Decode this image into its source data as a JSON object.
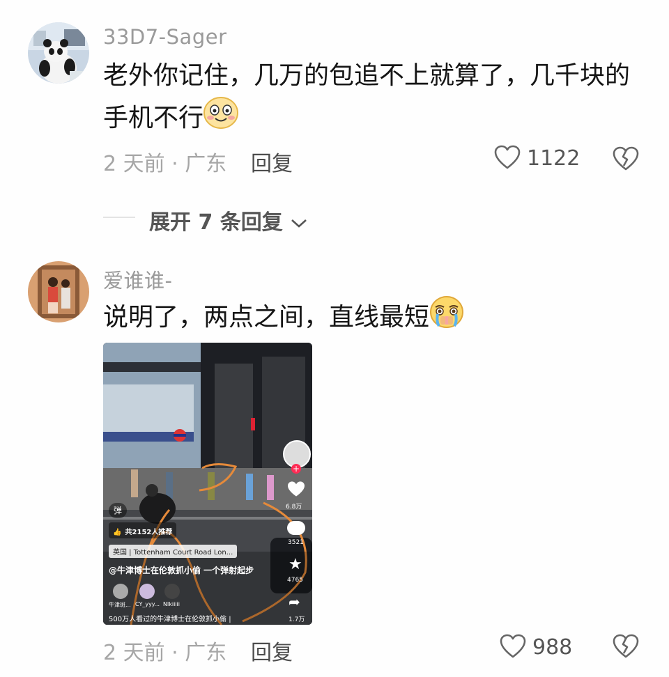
{
  "comments": [
    {
      "username": "33D7-Sager",
      "text_line1": "老外你记住，几万的包追不上就算了，几千块的",
      "text_line2": "手机不行",
      "time_location": "2 天前 · 广东",
      "reply_label": "回复",
      "like_count": "1122",
      "emoji": "grinning-face-emoji",
      "avatar": "panda-avatar"
    },
    {
      "username": "爱谁谁-",
      "text": "说明了，两点之间，直线最短",
      "time_location": "2 天前 · 广东",
      "reply_label": "回复",
      "like_count": "988",
      "emoji": "crying-face-emoji",
      "avatar": "mirror-selfie-avatar"
    }
  ],
  "expand_replies": {
    "label": "展开 7 条回复"
  },
  "video": {
    "recommend_badge": "共2152人推荐",
    "danmu_icon": "弹",
    "location": "英国 | Tottenham Court Road Lon...",
    "author_caption": "@牛津博士在伦敦抓小偷 一个弹射起步",
    "commenters": [
      "牛津斑...",
      "CY_yyy...",
      "Nlkiiiii"
    ],
    "bottom_caption": "500万人看过的牛津博士在伦敦抓小偷 |",
    "side_stats": {
      "likes": "6.8万",
      "comments": "3521",
      "favorites": "4765",
      "shares": "1.7万"
    }
  },
  "colors": {
    "accent_orange": "#e58a3a",
    "meta_gray": "#a6a6a6"
  }
}
